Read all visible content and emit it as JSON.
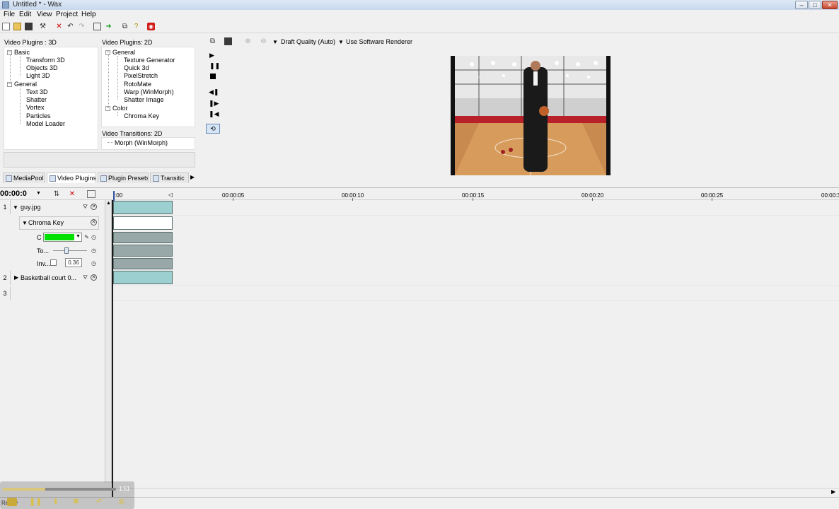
{
  "window": {
    "title": "Untitled * - Wax"
  },
  "menu": [
    "File",
    "Edit",
    "View",
    "Project",
    "Help"
  ],
  "plugins3d": {
    "header": "Video Plugins : 3D",
    "groups": [
      {
        "name": "Basic",
        "items": [
          "Transform 3D",
          "Objects 3D",
          "Light 3D"
        ]
      },
      {
        "name": "General",
        "items": [
          "Text 3D",
          "Shatter",
          "Vortex",
          "Particles",
          "Model Loader"
        ]
      }
    ]
  },
  "plugins2d": {
    "header": "Video Plugins: 2D",
    "groups": [
      {
        "name": "General",
        "items": [
          "Texture Generator",
          "Quick 3d",
          "PixelStretch",
          "RotoMate",
          "Warp (WinMorph)",
          "Shatter Image"
        ]
      },
      {
        "name": "Color",
        "items": [
          "Chroma Key"
        ]
      }
    ]
  },
  "transitions2d": {
    "header": "Video Transitions: 2D",
    "items": [
      "Morph (WinMorph)"
    ]
  },
  "tabs": [
    "MediaPool",
    "Video Plugins",
    "Plugin Presets",
    "Transitic"
  ],
  "preview_toolbar": {
    "quality": "Draft Quality (Auto)",
    "renderer": "Use Software Renderer"
  },
  "timeline": {
    "timecode": "00:00:0",
    "ruler": ":00",
    "ruler_labels": [
      "00:00:05",
      "00:00:10",
      "00:00:15",
      "00:00:20",
      "00:00:25",
      "00:00:3"
    ],
    "tracks": [
      {
        "num": "1",
        "name": "guy.jpg"
      },
      {
        "num": "2",
        "name": "Basketball court 0..."
      },
      {
        "num": "3",
        "name": ""
      }
    ],
    "effect": "Chroma Key",
    "params": {
      "color_label": "C",
      "tolerance_label": "To...",
      "tolerance_value": "0.36",
      "invert_label": "Inv..."
    },
    "key_color": "#00e000"
  },
  "status": {
    "ready": "Ready",
    "recorder_time": "1:51"
  }
}
